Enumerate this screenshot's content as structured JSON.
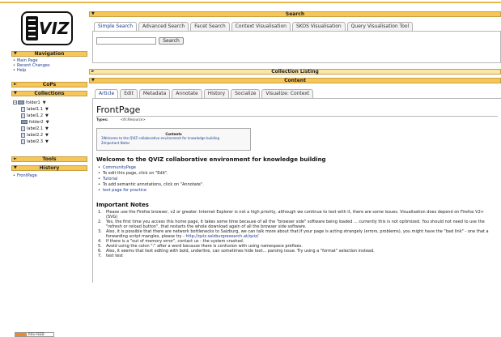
{
  "brand": {
    "logo_text": "VIZ"
  },
  "sidebar": {
    "navigation": {
      "title": "Navigation",
      "items": [
        "Main Page",
        "Recent Changes",
        "Help"
      ]
    },
    "cops": {
      "title": "CoPs"
    },
    "collections": {
      "title": "Collections",
      "tree": [
        {
          "label": "folder1",
          "kind": "folder",
          "level": 0
        },
        {
          "label": "label1.1",
          "kind": "file",
          "level": 1
        },
        {
          "label": "label1.2",
          "kind": "file",
          "level": 1
        },
        {
          "label": "folder2",
          "kind": "folder",
          "level": 1
        },
        {
          "label": "label2.1",
          "kind": "file",
          "level": 2
        },
        {
          "label": "label2.2",
          "kind": "file",
          "level": 2
        },
        {
          "label": "label2.3",
          "kind": "file",
          "level": 2
        }
      ]
    },
    "tools": {
      "title": "Tools"
    },
    "history": {
      "title": "History",
      "items": [
        "FrontPage"
      ]
    }
  },
  "search": {
    "title": "Search",
    "tabs": [
      "Simple Search",
      "Advanced Search",
      "Facet Search",
      "Context Visualisation",
      "SKOS Visualisation",
      "Query Visualisation Tool"
    ],
    "active_tab": 0,
    "input_value": "",
    "button_label": "Search"
  },
  "collection_listing": {
    "title": "Collection Listing"
  },
  "content": {
    "title": "Content",
    "tabs": [
      "Article",
      "Edit",
      "Metadata",
      "Annotate",
      "History",
      "Socialize",
      "Visualize: Context"
    ],
    "active_tab": 0,
    "page_title": "FrontPage",
    "types_label": "Types:",
    "types_value": "<ifs:Resource>",
    "toc": {
      "title": "Contents",
      "items": [
        "1Welcome to the QVIZ collaborative environment for knowledge building",
        "2Important Notes"
      ]
    },
    "welcome_heading": "Welcome to the QVIZ collaborative environment for knowledge building",
    "bullets": [
      {
        "text": "CommunityPage",
        "link": true
      },
      {
        "text": "To edit this page, click on \"Edit\".",
        "link": false
      },
      {
        "text": "Tutorial",
        "link": true
      },
      {
        "text": "To add semantic annotations, click on \"Annotate\".",
        "link": false
      },
      {
        "text": "test page for practice",
        "link": true
      }
    ],
    "notes_heading": "Important Notes",
    "notes": [
      "Please use the Firefox browser, v2 or greater. Internet Explorer is not a high priority, although we continue to test with it, there are some issues. Visualisation does depend on Firefox V2+ (SVG)",
      "Yes, the first time you access this home page, it takes some time because of all the \"browser side\" software being loaded ... currently this is not optimized. You should not need to use the \"refresh or reload button\", that restarts the whole download again of all the browser side software.",
      "Also, it is possible that there are network bottlenecks to Salzburg, we can talk more about that.If your page is acting strangely (errors, problems), you might have the \"bad link\" - one that a forwarding script mangles, please try - ",
      "If there is a \"out of memory error\", contact us - the system crashed.",
      "Avoid using the colon \":\" after a word because there is confusion with using namespace prefixes.",
      "Also, it seems that text editing with bold, underline, can sometimes hide text... parsing issue. Try using a \"format\" selection instead.",
      "test test"
    ],
    "note3_link": "http://qviz.salzburgresearch.at/qviz/"
  },
  "footer": {
    "badge_text": "RSS FEED"
  },
  "colors": {
    "bar": "#f5c75a",
    "link": "#1a3a8f"
  }
}
